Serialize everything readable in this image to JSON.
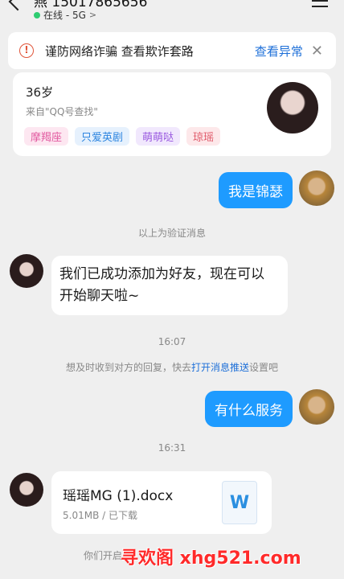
{
  "header": {
    "title": "燕 15017865656",
    "status_text": "在线 - 5G",
    "status_chevron": ">"
  },
  "warning": {
    "icon": "!",
    "text": "谨防网络诈骗 查看欺诈套路",
    "link": "查看异常",
    "close": "✕"
  },
  "profile": {
    "age": "36岁",
    "source": "来自\"QQ号查找\"",
    "tags": [
      {
        "label": "摩羯座",
        "color": "#e25aa0",
        "bg": "#fde7f1"
      },
      {
        "label": "只爱英剧",
        "color": "#2f86e0",
        "bg": "#e6f1fd"
      },
      {
        "label": "萌萌哒",
        "color": "#9a5ae0",
        "bg": "#f1e8fd"
      },
      {
        "label": "琼瑶",
        "color": "#e05a6a",
        "bg": "#fde8ea"
      }
    ]
  },
  "messages": {
    "m1": "我是锦瑟",
    "sys1": "以上为验证消息",
    "m2_line1": "我们已成功添加为好友，现在可以",
    "m2_line2": "开始聊天啦~",
    "time1": "16:07",
    "sys2_a": "想及时收到对方的回复，快去",
    "sys2_link": "打开消息推送",
    "sys2_b": "设置吧",
    "m3": "有什么服务",
    "time2": "16:31"
  },
  "file": {
    "name": "瑶瑶MG (1).docx",
    "meta": "5.01MB / 已下载",
    "icon_letter": "W"
  },
  "footer": {
    "text": "你们开启",
    "watermark": "寻欢阁 xhg521.com"
  }
}
